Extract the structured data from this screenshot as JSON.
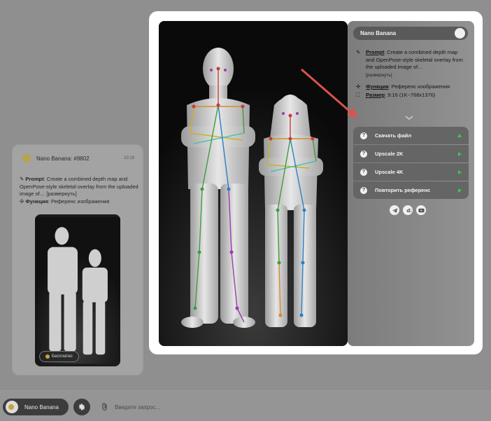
{
  "chat_card": {
    "title": "Nano Banana: #9802",
    "time": "10:19",
    "prompt_label": "Prompt",
    "prompt_text": "Create a combined depth map and OpenPose-style skeletal overlay from the uploaded image of…",
    "expand": "[развернуть]",
    "function_label": "Функция",
    "function_value": "Референс изображения",
    "free_badge": "Бесплатно"
  },
  "modal": {
    "panel_title": "Nano Banana",
    "prompt_label": "Prompt",
    "prompt_text": "Create a combined depth map and OpenPose-style skeletal overlay from the uploaded image of…",
    "expand": "[развернуть]",
    "function_label": "Функция",
    "function_value": "Референс изображения",
    "size_label": "Размер",
    "size_value": "9:16 (1K~768x1376)",
    "actions": [
      {
        "label": "Скачать файл"
      },
      {
        "label": "Upscale 2K"
      },
      {
        "label": "Upscale 4K"
      },
      {
        "label": "Повторить референс"
      }
    ],
    "socials": [
      "telegram-icon",
      "vk-icon",
      "youtube-icon"
    ]
  },
  "bottom_bar": {
    "model_name": "Nano Banana",
    "input_placeholder": "Введите запрос..."
  },
  "colors": {
    "accent_green": "#38c95a",
    "annotation_arrow": "#d9534f",
    "skeleton_colors": [
      "#c63b3b",
      "#d88a2a",
      "#c9b12b",
      "#3f9c3f",
      "#2b7fc4",
      "#9b3ab3",
      "#3bbfa8"
    ]
  }
}
